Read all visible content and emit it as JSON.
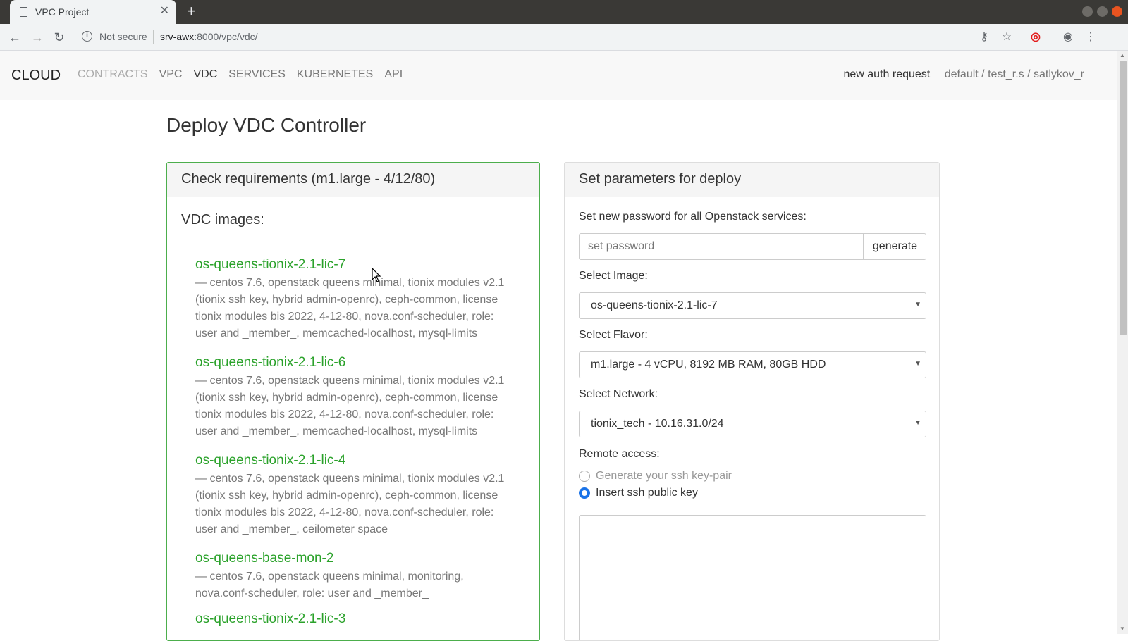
{
  "browser": {
    "tab_title": "VPC Project",
    "tab_close": "✕",
    "new_tab": "+",
    "not_secure": "Not secure",
    "url_host": "srv-awx",
    "url_rest": ":8000/vpc/vdc/"
  },
  "navbar": {
    "brand": "CLOUD",
    "links": [
      "CONTRACTS",
      "VPC",
      "VDC",
      "SERVICES",
      "KUBERNETES",
      "API"
    ],
    "auth_link": "new auth request",
    "context": "default / test_r.s / satlykov_r"
  },
  "page": {
    "title": "Deploy VDC Controller"
  },
  "requirements": {
    "heading": "Check requirements (m1.large - 4/12/80)",
    "images_title": "VDC images:",
    "images": [
      {
        "name": "os-queens-tionix-2.1-lic-7",
        "desc": "— centos 7.6, openstack queens minimal, tionix modules v2.1 (tionix ssh key, hybrid admin-openrc), ceph-common, license tionix modules bis 2022, 4-12-80, nova.conf-scheduler, role: user and _member_, memcached-localhost, mysql-limits"
      },
      {
        "name": "os-queens-tionix-2.1-lic-6",
        "desc": "— centos 7.6, openstack queens minimal, tionix modules v2.1 (tionix ssh key, hybrid admin-openrc), ceph-common, license tionix modules bis 2022, 4-12-80, nova.conf-scheduler, role: user and _member_, memcached-localhost, mysql-limits"
      },
      {
        "name": "os-queens-tionix-2.1-lic-4",
        "desc": "— centos 7.6, openstack queens minimal, tionix modules v2.1 (tionix ssh key, hybrid admin-openrc), ceph-common, license tionix modules bis 2022, 4-12-80, nova.conf-scheduler, role: user and _member_, ceilometer space"
      },
      {
        "name": "os-queens-base-mon-2",
        "desc": "— centos 7.6, openstack queens minimal, monitoring, nova.conf-scheduler, role: user and _member_"
      },
      {
        "name": "os-queens-tionix-2.1-lic-3",
        "desc": ""
      }
    ]
  },
  "deploy": {
    "heading": "Set parameters for deploy",
    "password_label": "Set new password for all Openstack services:",
    "password_placeholder": "set password",
    "generate_label": "generate",
    "image_label": "Select Image:",
    "image_value": "os-queens-tionix-2.1-lic-7",
    "flavor_label": "Select Flavor:",
    "flavor_value": "m1.large - 4 vCPU, 8192 MB RAM, 80GB HDD",
    "network_label": "Select Network:",
    "network_value": "tionix_tech - 10.16.31.0/24",
    "remote_label": "Remote access:",
    "radio_generate": "Generate your ssh key-pair",
    "radio_insert": "Insert ssh public key"
  },
  "colors": {
    "accent_green": "#2ba22b",
    "panel_border_green": "#4cae4c",
    "radio_blue": "#1a73e8"
  }
}
